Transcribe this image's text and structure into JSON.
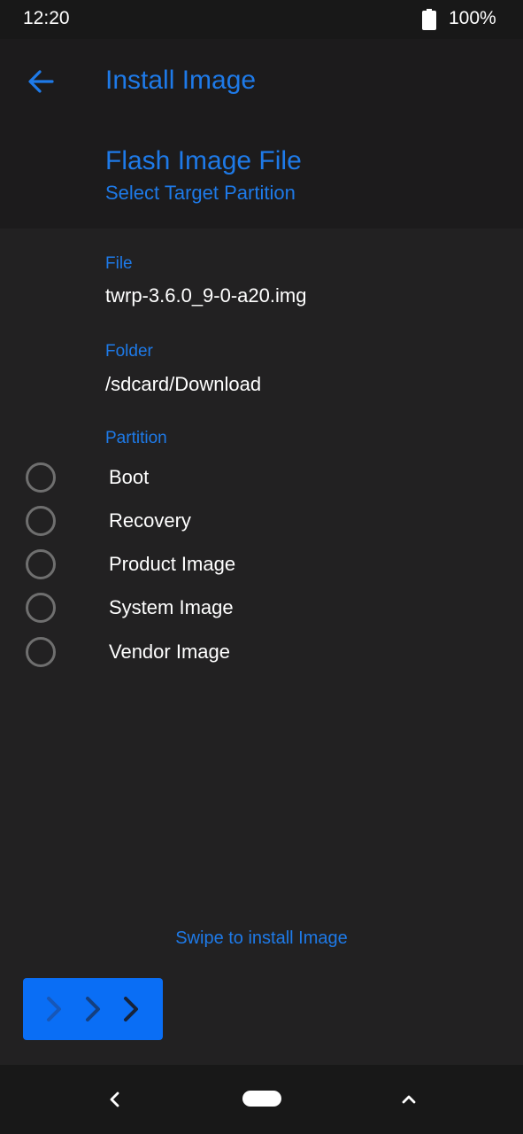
{
  "status_bar": {
    "time": "12:20",
    "battery_percent": "100%",
    "battery_icon": "battery-full-icon"
  },
  "header": {
    "back_icon": "arrow-left-icon",
    "title": "Install Image",
    "section_title": "Flash Image File",
    "section_subtitle": "Select Target Partition"
  },
  "file": {
    "label": "File",
    "value": "twrp-3.6.0_9-0-a20.img"
  },
  "folder": {
    "label": "Folder",
    "value": "/sdcard/Download"
  },
  "partition": {
    "label": "Partition",
    "options": [
      {
        "label": "Boot",
        "selected": false
      },
      {
        "label": "Recovery",
        "selected": false
      },
      {
        "label": "Product Image",
        "selected": false
      },
      {
        "label": "System Image",
        "selected": false
      },
      {
        "label": "Vendor Image",
        "selected": false
      }
    ]
  },
  "swipe": {
    "hint": "Swipe to install Image",
    "handle_icons": [
      "chevron-right-icon",
      "chevron-right-icon",
      "chevron-right-icon"
    ]
  },
  "nav_bar": {
    "back_icon": "nav-back-icon",
    "home_icon": "home-pill-icon",
    "recents_icon": "chevron-up-icon"
  },
  "colors": {
    "accent": "#1e7ae8",
    "swipe_button": "#0a6ef5",
    "background": "#222122",
    "header_background": "#1c1b1c",
    "radio_border": "#6f6f6f"
  }
}
